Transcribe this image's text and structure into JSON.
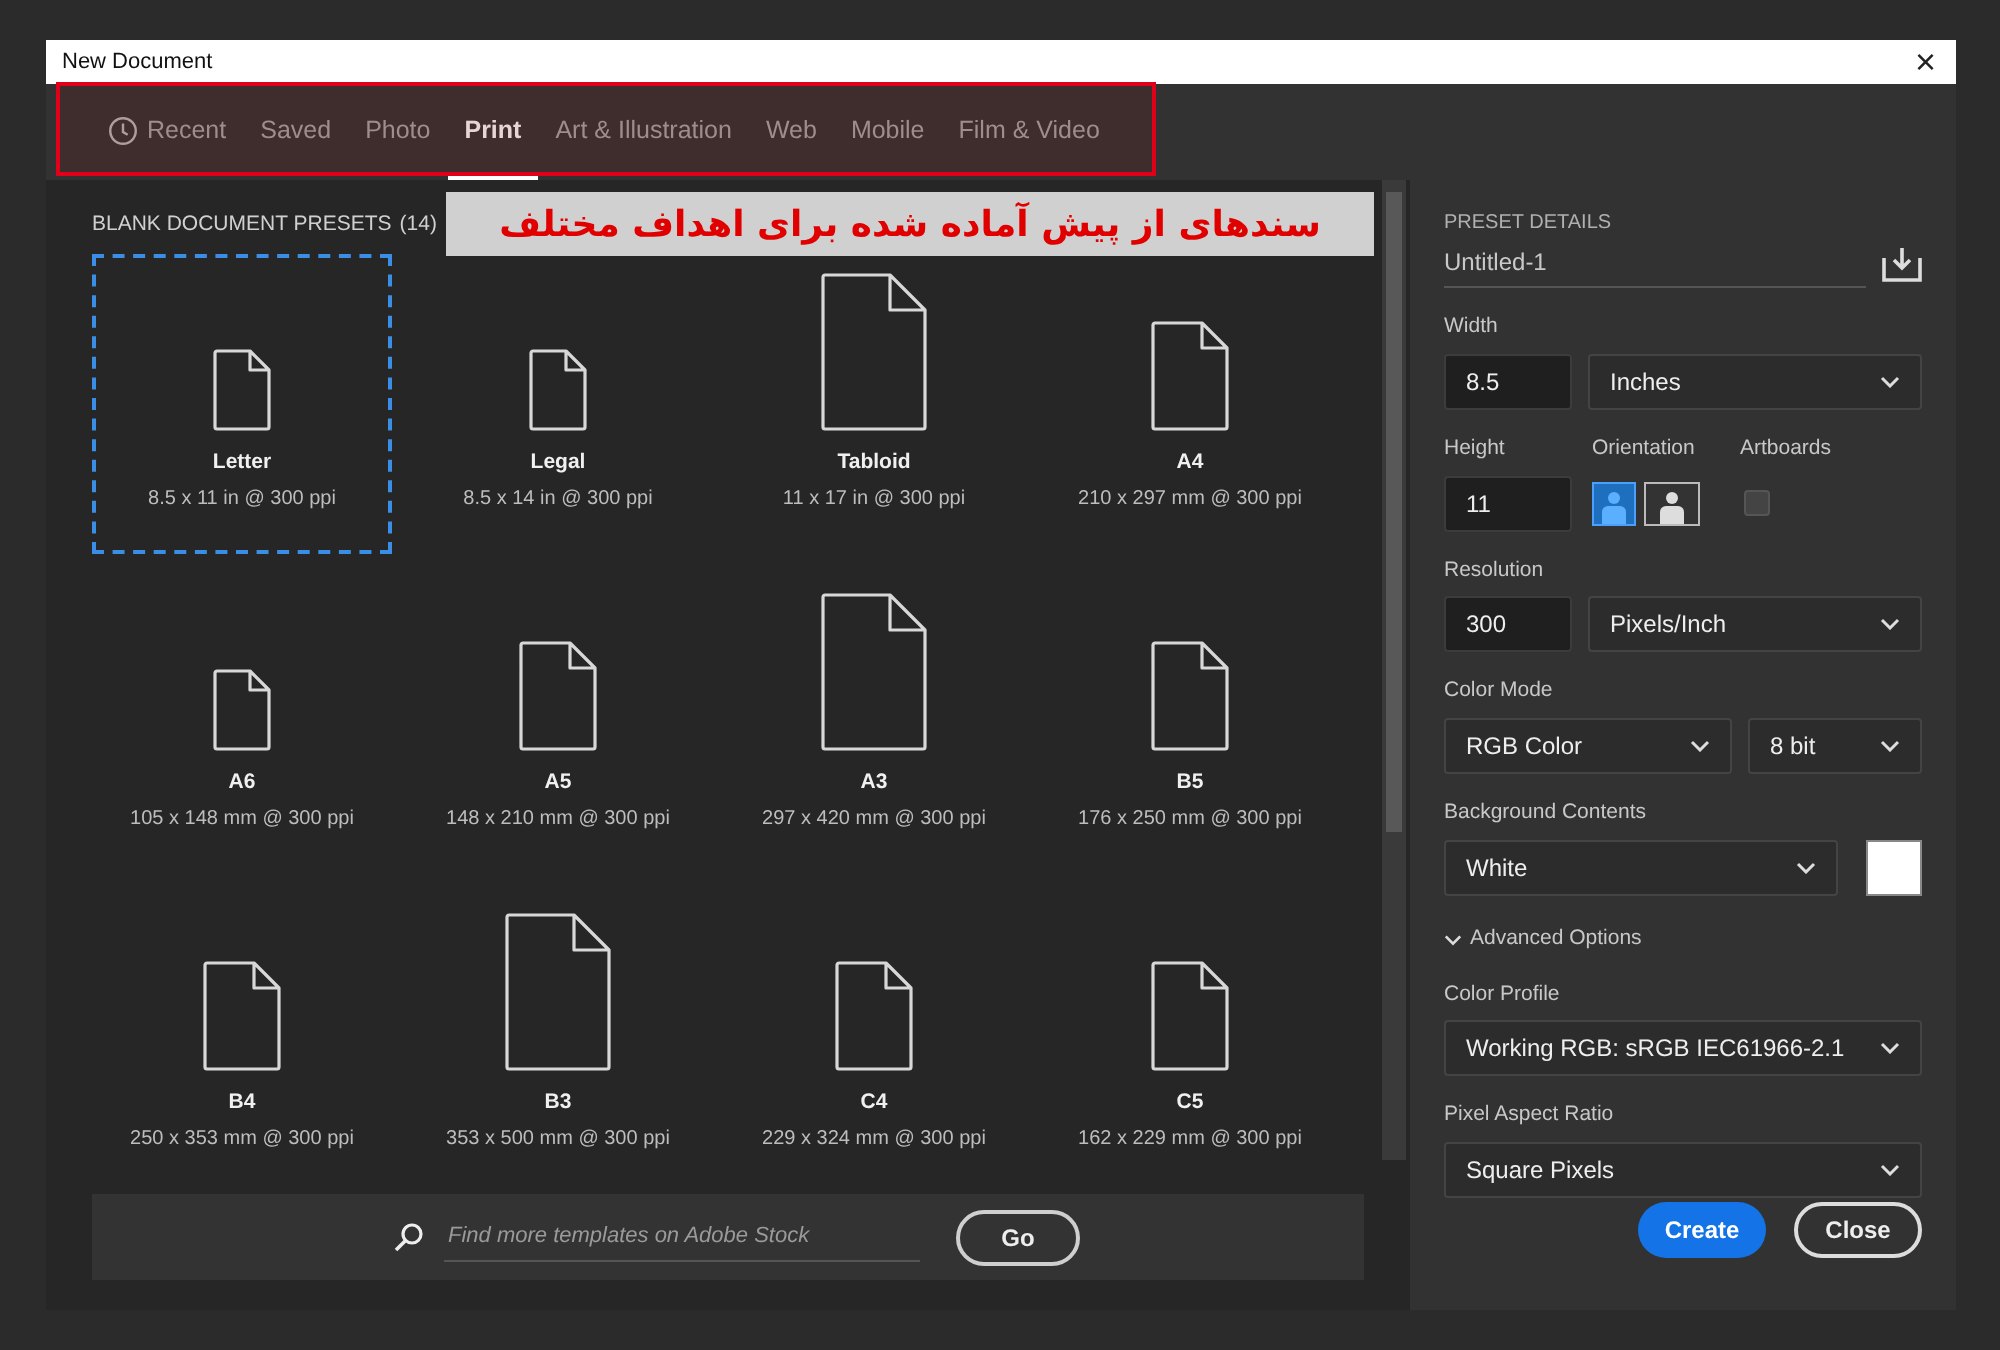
{
  "window": {
    "title": "New Document",
    "close": "×"
  },
  "tabs": [
    {
      "label": "Recent",
      "selected": false,
      "kind": "clock"
    },
    {
      "label": "Saved",
      "selected": false
    },
    {
      "label": "Photo",
      "selected": false
    },
    {
      "label": "Print",
      "selected": true
    },
    {
      "label": "Art & Illustration",
      "selected": false
    },
    {
      "label": "Web",
      "selected": false
    },
    {
      "label": "Mobile",
      "selected": false
    },
    {
      "label": "Film & Video",
      "selected": false
    }
  ],
  "presets_header": {
    "title": "BLANK DOCUMENT PRESETS",
    "count": "(14)"
  },
  "presets": [
    {
      "name": "Letter",
      "size": "8.5 x 11 in @ 300 ppi",
      "kind": "small",
      "selected": true
    },
    {
      "name": "Legal",
      "size": "8.5 x 14 in @ 300 ppi",
      "kind": "small",
      "selected": false
    },
    {
      "name": "Tabloid",
      "size": "11 x 17 in @ 300 ppi",
      "kind": "large",
      "selected": false
    },
    {
      "name": "A4",
      "size": "210 x 297 mm @ 300 ppi",
      "kind": "medium",
      "selected": false
    },
    {
      "name": "A6",
      "size": "105 x 148 mm @ 300 ppi",
      "kind": "small",
      "selected": false
    },
    {
      "name": "A5",
      "size": "148 x 210 mm @ 300 ppi",
      "kind": "medium",
      "selected": false
    },
    {
      "name": "A3",
      "size": "297 x 420 mm @ 300 ppi",
      "kind": "large",
      "selected": false
    },
    {
      "name": "B5",
      "size": "176 x 250 mm @ 300 ppi",
      "kind": "medium",
      "selected": false
    },
    {
      "name": "B4",
      "size": "250 x 353 mm @ 300 ppi",
      "kind": "medium",
      "selected": false
    },
    {
      "name": "B3",
      "size": "353 x 500 mm @ 300 ppi",
      "kind": "large",
      "selected": false
    },
    {
      "name": "C4",
      "size": "229 x 324 mm @ 300 ppi",
      "kind": "medium",
      "selected": false
    },
    {
      "name": "C5",
      "size": "162 x 229 mm @ 300 ppi",
      "kind": "medium",
      "selected": false
    }
  ],
  "stock_search": {
    "placeholder": "Find more templates on Adobe Stock",
    "button": "Go"
  },
  "details": {
    "heading": "PRESET DETAILS",
    "name": "Untitled-1",
    "width": {
      "label": "Width",
      "value": "8.5",
      "unit": "Inches"
    },
    "height": {
      "label": "Height",
      "value": "11"
    },
    "orientation": {
      "label": "Orientation",
      "options": [
        {
          "kind": "portrait",
          "selected": true
        },
        {
          "kind": "landscape",
          "selected": false
        }
      ]
    },
    "artboards": {
      "label": "Artboards",
      "checked": false
    },
    "resolution": {
      "label": "Resolution",
      "value": "300",
      "unit": "Pixels/Inch"
    },
    "color_mode": {
      "label": "Color Mode",
      "mode": "RGB Color",
      "depth": "8 bit"
    },
    "background": {
      "label": "Background Contents",
      "value": "White",
      "color": "#ffffff"
    },
    "advanced": {
      "label": "Advanced Options",
      "expanded": true
    },
    "color_profile": {
      "label": "Color Profile",
      "value": "Working RGB: sRGB IEC61966-2.1"
    },
    "pixel_aspect": {
      "label": "Pixel Aspect Ratio",
      "value": "Square Pixels"
    }
  },
  "buttons": [
    {
      "label": "Create",
      "kind": "primary"
    },
    {
      "label": "Close",
      "kind": "outline"
    }
  ],
  "annotation": {
    "text": "سندهای از پیش آماده شده برای اهداف مختلف"
  }
}
